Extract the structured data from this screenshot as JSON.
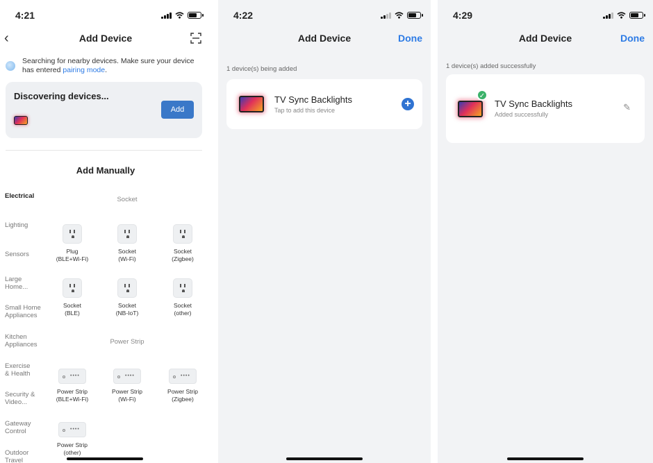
{
  "screen1": {
    "time": "4:21",
    "title": "Add Device",
    "search_text": "Searching for nearby devices. Make sure your device has entered ",
    "pairing_link": "pairing mode",
    "search_period": ".",
    "discovering": "Discovering devices...",
    "add_button": "Add",
    "add_manually": "Add Manually",
    "categories": [
      "Electrical",
      "Lighting",
      "Sensors",
      "Large Home...",
      "Small Home Appliances",
      "Kitchen Appliances",
      "Exercise & Health",
      "Security & Video...",
      "Gateway Control",
      "Outdoor Travel"
    ],
    "socket_section": "Socket",
    "sockets": [
      {
        "name": "Plug",
        "sub": "(BLE+Wi-Fi)"
      },
      {
        "name": "Socket",
        "sub": "(Wi-Fi)"
      },
      {
        "name": "Socket",
        "sub": "(Zigbee)"
      },
      {
        "name": "Socket",
        "sub": "(BLE)"
      },
      {
        "name": "Socket",
        "sub": "(NB-IoT)"
      },
      {
        "name": "Socket",
        "sub": "(other)"
      }
    ],
    "strip_section": "Power Strip",
    "strips": [
      {
        "name": "Power Strip",
        "sub": "(BLE+Wi-Fi)"
      },
      {
        "name": "Power Strip",
        "sub": "(Wi-Fi)"
      },
      {
        "name": "Power Strip",
        "sub": "(Zigbee)"
      },
      {
        "name": "Power Strip",
        "sub": "(other)"
      }
    ]
  },
  "screen2": {
    "time": "4:22",
    "title": "Add Device",
    "done": "Done",
    "meta": "1 device(s) being added",
    "device_name": "TV Sync Backlights",
    "device_sub": "Tap to add this device"
  },
  "screen3": {
    "time": "4:29",
    "title": "Add Device",
    "done": "Done",
    "meta": "1 device(s) added successfully",
    "device_name": "TV Sync Backlights",
    "device_sub": "Added successfully"
  },
  "icons": {
    "back": "chevron-left-icon",
    "scan": "scan-icon",
    "add": "plus-circle-icon",
    "success": "check-icon",
    "edit": "pencil-icon"
  },
  "colors": {
    "accent": "#2d7be5",
    "add_button": "#3a78c8",
    "success": "#3bb26a"
  }
}
